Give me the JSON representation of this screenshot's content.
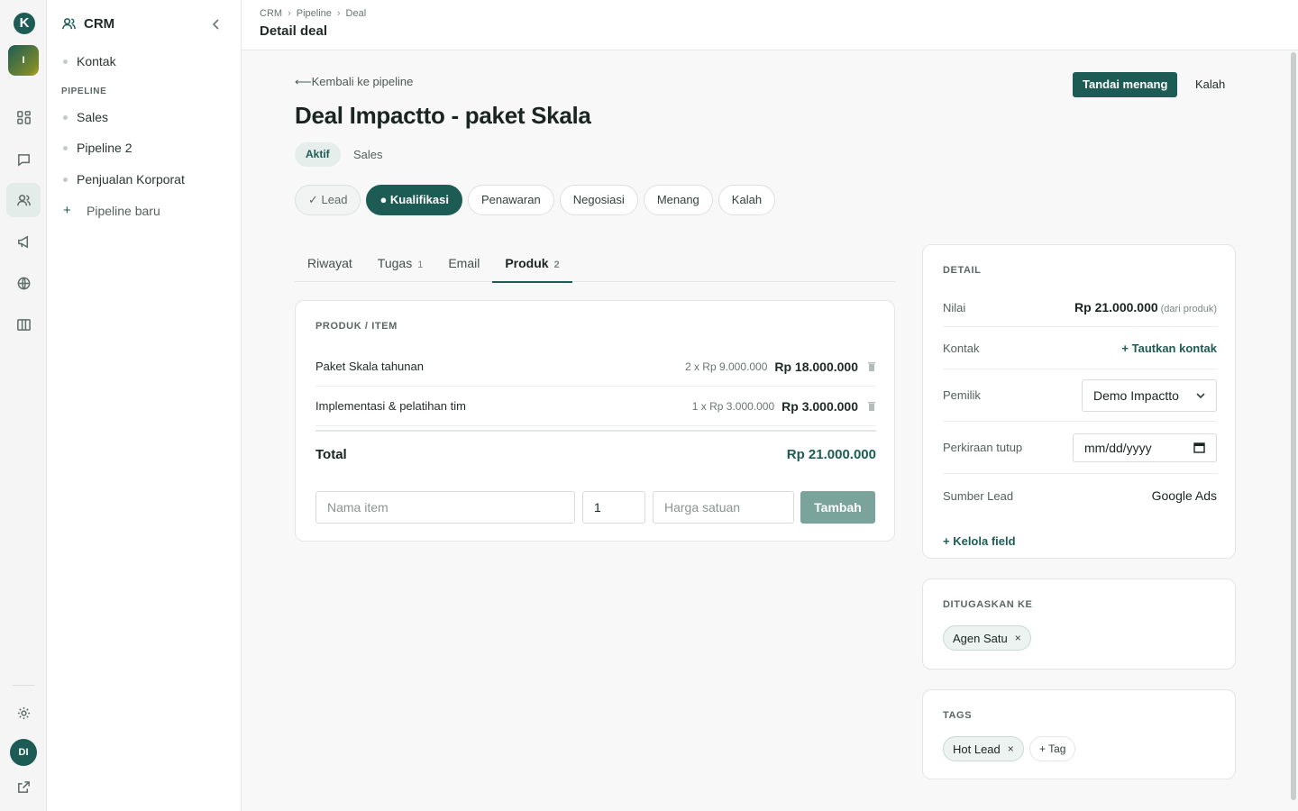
{
  "rail": {
    "logo": "K",
    "workspace": "I",
    "avatar": "DI",
    "icons": [
      "dashboard-icon",
      "chat-icon",
      "contacts-icon",
      "megaphone-icon",
      "globe-icon",
      "columns-icon",
      "settings-icon",
      "external-link-icon"
    ]
  },
  "sidebar": {
    "title": "CRM",
    "items": [
      {
        "label": "Kontak"
      }
    ],
    "section_label": "PIPELINE",
    "pipelines": [
      {
        "label": "Sales"
      },
      {
        "label": "Pipeline 2"
      },
      {
        "label": "Penjualan Korporat"
      }
    ],
    "new_pipeline": "Pipeline baru"
  },
  "header": {
    "breadcrumb": [
      "CRM",
      "Pipeline",
      "Deal"
    ],
    "title": "Detail deal"
  },
  "deal": {
    "back_link": "⟵Kembali ke pipeline",
    "title": "Deal Impactto - paket Skala",
    "status": "Aktif",
    "pipeline": "Sales",
    "win_label": "Tandai menang",
    "lose_label": "Kalah",
    "stages": [
      {
        "label": "✓  Lead",
        "state": "done"
      },
      {
        "label": "●  Kualifikasi",
        "state": "current"
      },
      {
        "label": "Penawaran",
        "state": "todo"
      },
      {
        "label": "Negosiasi",
        "state": "todo"
      },
      {
        "label": "Menang",
        "state": "todo"
      },
      {
        "label": "Kalah",
        "state": "todo"
      }
    ]
  },
  "tabs": [
    {
      "label": "Riwayat",
      "count": ""
    },
    {
      "label": "Tugas",
      "count": "1"
    },
    {
      "label": "Email",
      "count": ""
    },
    {
      "label": "Produk",
      "count": "2"
    }
  ],
  "products": {
    "section_label": "PRODUK / ITEM",
    "rows": [
      {
        "name": "Paket Skala tahunan",
        "qty": "2 x Rp 9.000.000",
        "subtotal": "Rp 18.000.000"
      },
      {
        "name": "Implementasi & pelatihan tim",
        "qty": "1 x Rp 3.000.000",
        "subtotal": "Rp 3.000.000"
      }
    ],
    "total_label": "Total",
    "total_value": "Rp 21.000.000",
    "name_placeholder": "Nama item",
    "qty_value": "1",
    "price_placeholder": "Harga satuan",
    "add_label": "Tambah"
  },
  "detail": {
    "section_label": "DETAIL",
    "value_label": "Nilai",
    "value": "Rp 21.000.000",
    "value_note": "(dari produk)",
    "contact_label": "Kontak",
    "contact_link": "+ Tautkan kontak",
    "owner_label": "Pemilik",
    "owner_value": "Demo Impactto",
    "close_label": "Perkiraan tutup",
    "close_value": "mm/dd/yyyy",
    "source_label": "Sumber Lead",
    "source_value": "Google Ads",
    "manage_fields": "+ Kelola field"
  },
  "assigned": {
    "section_label": "DITUGASKAN KE",
    "agent": "Agen Satu"
  },
  "tags": {
    "section_label": "TAGS",
    "items": [
      "Hot Lead"
    ],
    "add_label": "+ Tag"
  },
  "colors": {
    "accent": "#1d5c54",
    "accent_muted": "#7aa39c"
  }
}
